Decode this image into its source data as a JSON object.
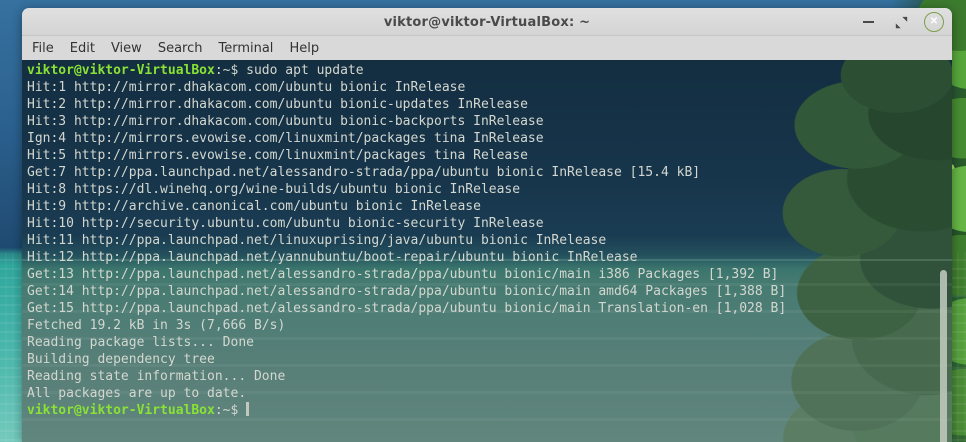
{
  "window": {
    "title": "viktor@viktor-VirtualBox: ~",
    "controls": {
      "minimize_icon": "dash",
      "maximize_icon": "diagonal-resize-arrows",
      "close_icon": "x-in-green-circle",
      "close_glyph": "✕"
    }
  },
  "menu": {
    "items": [
      "File",
      "Edit",
      "View",
      "Search",
      "Terminal",
      "Help"
    ]
  },
  "terminal": {
    "lines": [
      {
        "prompt": "viktor@viktor-VirtualBox",
        "suffix": ":~$",
        "command": "sudo apt update"
      },
      {
        "text": "Hit:1 http://mirror.dhakacom.com/ubuntu bionic InRelease"
      },
      {
        "text": "Hit:2 http://mirror.dhakacom.com/ubuntu bionic-updates InRelease"
      },
      {
        "text": "Hit:3 http://mirror.dhakacom.com/ubuntu bionic-backports InRelease"
      },
      {
        "text": "Ign:4 http://mirrors.evowise.com/linuxmint/packages tina InRelease"
      },
      {
        "text": "Hit:5 http://mirrors.evowise.com/linuxmint/packages tina Release"
      },
      {
        "text": "Get:7 http://ppa.launchpad.net/alessandro-strada/ppa/ubuntu bionic InRelease [15.4 kB]"
      },
      {
        "text": "Hit:8 https://dl.winehq.org/wine-builds/ubuntu bionic InRelease"
      },
      {
        "text": "Hit:9 http://archive.canonical.com/ubuntu bionic InRelease"
      },
      {
        "text": "Hit:10 http://security.ubuntu.com/ubuntu bionic-security InRelease"
      },
      {
        "text": "Hit:11 http://ppa.launchpad.net/linuxuprising/java/ubuntu bionic InRelease"
      },
      {
        "text": "Hit:12 http://ppa.launchpad.net/yannubuntu/boot-repair/ubuntu bionic InRelease"
      },
      {
        "text": "Get:13 http://ppa.launchpad.net/alessandro-strada/ppa/ubuntu bionic/main i386 Packages [1,392 B]"
      },
      {
        "text": "Get:14 http://ppa.launchpad.net/alessandro-strada/ppa/ubuntu bionic/main amd64 Packages [1,388 B]"
      },
      {
        "text": "Get:15 http://ppa.launchpad.net/alessandro-strada/ppa/ubuntu bionic/main Translation-en [1,028 B]"
      },
      {
        "text": "Fetched 19.2 kB in 3s (7,666 B/s)"
      },
      {
        "text": "Reading package lists... Done"
      },
      {
        "text": "Building dependency tree"
      },
      {
        "text": "Reading state information... Done"
      },
      {
        "text": "All packages are up to date."
      },
      {
        "prompt": "viktor@viktor-VirtualBox",
        "suffix": ":~$",
        "cursor": true
      }
    ],
    "colors": {
      "prompt_green": "#8ae234",
      "foreground": "#d3d7cf",
      "background_top": "#16344a",
      "background_bottom": "#60867e"
    }
  }
}
